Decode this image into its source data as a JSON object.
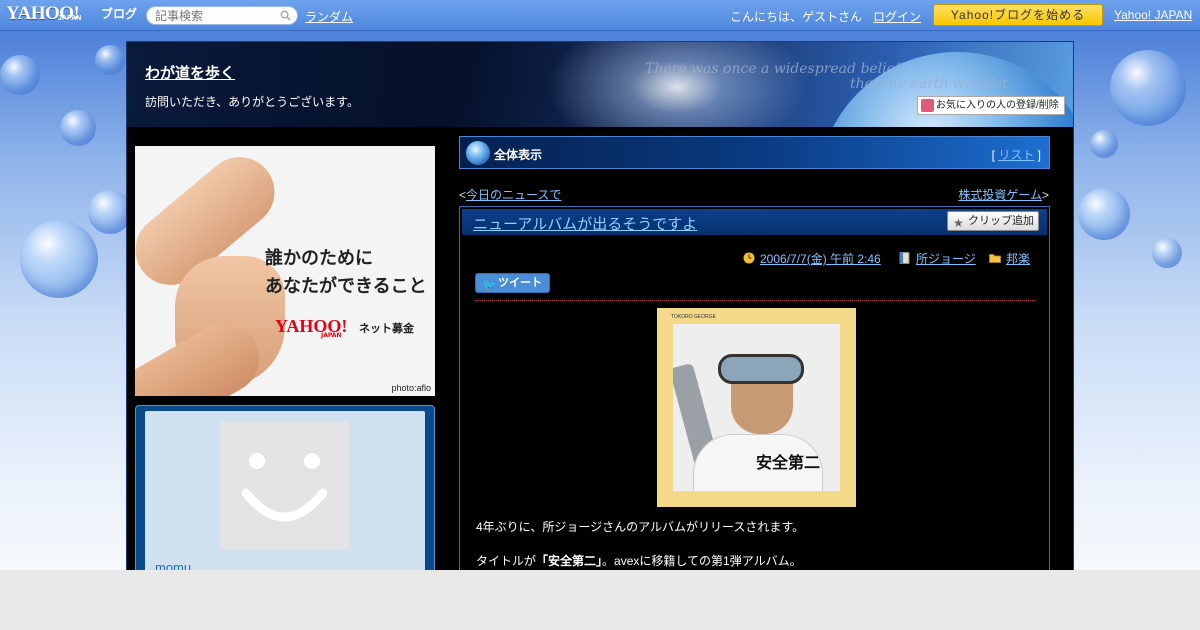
{
  "topbar": {
    "logo": "YAHOO!",
    "logo_sub": "JAPAN",
    "logo_blog": "ブログ",
    "search_placeholder": "記事検索",
    "random_link": "ランダム",
    "greeting": "こんにちは、ゲストさん",
    "login_link": "ログイン",
    "start_button": "Yahoo!ブログを始める",
    "yahoo_japan_link": "Yahoo! JAPAN"
  },
  "header": {
    "blog_title": "わが道を歩く",
    "description": "訪問いただき、ありがとうございます。",
    "quote_line1": "There was once a widespread belief",
    "quote_line2": "that the earth was flat",
    "fav_button": "お気に入りの人の登録/削除"
  },
  "sidebar": {
    "ad": {
      "line1": "誰かのために",
      "line2": "あなたができること",
      "brand": "YAHOO!",
      "brand_sub": "JAPAN",
      "service": "ネット募金",
      "credit": "photo:aflo"
    },
    "profile": {
      "name": "momu"
    }
  },
  "main": {
    "menubar": {
      "title": "全体表示",
      "list_open": "[ ",
      "list_link": "リスト",
      "list_close": " ]"
    },
    "nav": {
      "prev_arrow": "<",
      "prev_link": "今日のニュースで",
      "next_link": "株式投資ゲーム",
      "next_arrow": ">"
    },
    "post": {
      "title": "ニューアルバムが出るそうですよ",
      "clip_button": "クリップ追加",
      "date": "2006/7/7(金) 午前 2:46",
      "author": "所ジョージ",
      "category": "邦楽",
      "tweet_button": "ツイート",
      "album_top_text": "TOKORO GEORGE",
      "album_text": "安全第二",
      "paragraph1": "4年ぶりに、所ジョージさんのアルバムがリリースされます。",
      "paragraph2_pre": "タイトルが",
      "paragraph2_bold": "「安全第二」",
      "paragraph2_post": "。avexに移籍しての第1弾アルバム。"
    }
  },
  "colors": {
    "topbar": "#4f87dd",
    "start_button": "#f7c600",
    "link": "#7fc4ff",
    "frame_background": "#000000"
  }
}
